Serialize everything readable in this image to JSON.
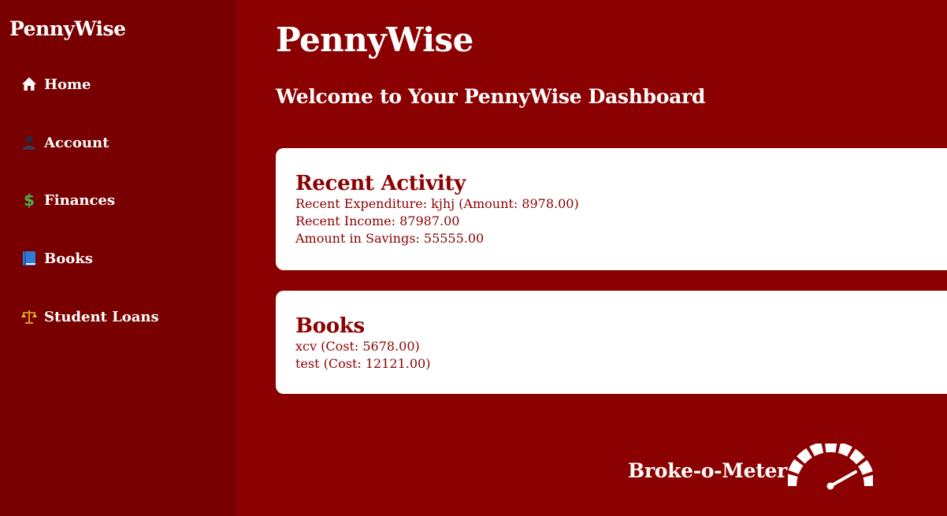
{
  "sidebar": {
    "brand": "PennyWise",
    "items": [
      {
        "label": "Home",
        "icon": "home-icon"
      },
      {
        "label": "Account",
        "icon": "user-icon"
      },
      {
        "label": "Finances",
        "icon": "dollar-icon"
      },
      {
        "label": "Books",
        "icon": "book-icon"
      },
      {
        "label": "Student Loans",
        "icon": "scales-icon"
      }
    ]
  },
  "main": {
    "title": "PennyWise",
    "subtitle": "Welcome to Your PennyWise Dashboard",
    "recent_activity": {
      "title": "Recent Activity",
      "lines": [
        "Recent Expenditure: kjhj (Amount: 8978.00)",
        "Recent Income: 87987.00",
        "Amount in Savings: 55555.00"
      ]
    },
    "books": {
      "title": "Books",
      "lines": [
        "xcv (Cost: 5678.00)",
        "test (Cost: 12121.00)"
      ]
    },
    "meter": {
      "label": "Broke-o-Meter",
      "icon": "gauge-icon"
    }
  },
  "colors": {
    "background": "#8b0000",
    "sidebar": "#780000",
    "card": "#ffffff",
    "accent_text": "#8b0000"
  }
}
